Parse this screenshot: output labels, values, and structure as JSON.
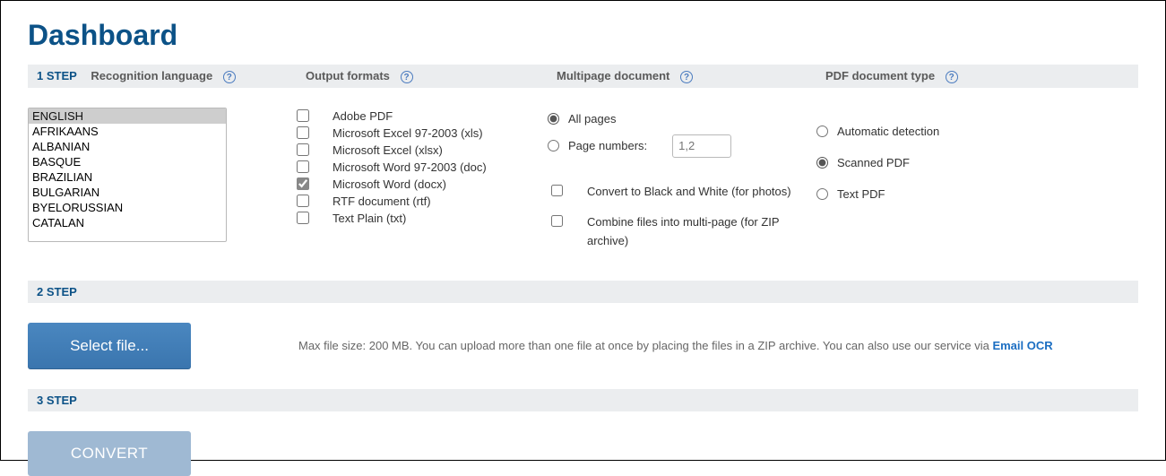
{
  "title": "Dashboard",
  "step1": {
    "num": "1 STEP",
    "headers": {
      "language": "Recognition language",
      "formats": "Output formats",
      "multipage": "Multipage document",
      "pdftype": "PDF document type"
    },
    "languages": [
      "ENGLISH",
      "AFRIKAANS",
      "ALBANIAN",
      "BASQUE",
      "BRAZILIAN",
      "BULGARIAN",
      "BYELORUSSIAN",
      "CATALAN"
    ],
    "formats": [
      {
        "label": "Adobe PDF",
        "checked": false
      },
      {
        "label": "Microsoft Excel 97-2003 (xls)",
        "checked": false
      },
      {
        "label": "Microsoft Excel (xlsx)",
        "checked": false
      },
      {
        "label": "Microsoft Word 97-2003 (doc)",
        "checked": false
      },
      {
        "label": "Microsoft Word (docx)",
        "checked": true
      },
      {
        "label": "RTF document (rtf)",
        "checked": false
      },
      {
        "label": "Text Plain (txt)",
        "checked": false
      }
    ],
    "multipage": {
      "all_label": "All pages",
      "range_label": "Page numbers:",
      "range_placeholder": "1,2",
      "bw_label": "Convert to Black and White (for photos)",
      "combine_label": "Combine files into multi-page (for ZIP archive)"
    },
    "pdftype": {
      "auto": "Automatic detection",
      "scanned": "Scanned PDF",
      "text": "Text PDF"
    }
  },
  "step2": {
    "num": "2 STEP",
    "button": "Select file...",
    "help_pre": "Max file size: 200 MB. You can upload more than one file at once by placing the files in a ZIP archive. You can also use our service via ",
    "link": "Email OCR"
  },
  "step3": {
    "num": "3 STEP",
    "button": "CONVERT"
  }
}
